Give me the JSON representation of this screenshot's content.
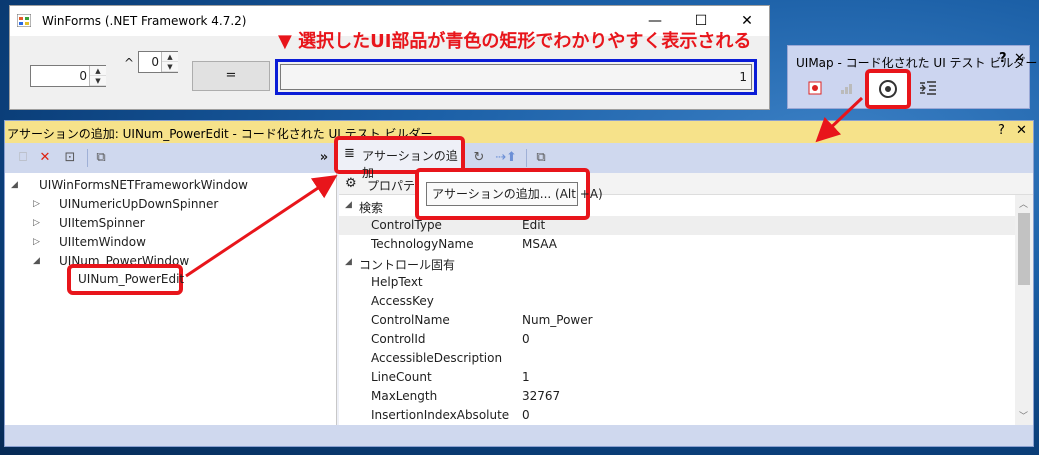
{
  "winforms": {
    "title": "WinForms (.NET Framework 4.7.2)",
    "minimize": "—",
    "maximize": "☐",
    "close": "✕",
    "spinner1_value": "0",
    "caret": "^",
    "spinner2_value": "0",
    "equals_label": "=",
    "result_value": "1"
  },
  "annotation": "▼ 選択したUI部品が青色の矩形でわかりやすく表示される",
  "uimap": {
    "title": "UIMap - コード化された UI テスト ビルダー",
    "help": "?",
    "close": "✕"
  },
  "builder": {
    "title": "アサーションの追加: UINum_PowerEdit - コード化された UI テスト ビルダー",
    "help": "?",
    "close": "✕",
    "toolbar": {
      "chevron": "»",
      "add_assertion": "アサーションの追加"
    },
    "tooltip": "アサーションの追加... (Alt +A)",
    "tree": [
      {
        "label": "UIWinFormsNETFrameworkWindow",
        "expander": "◢"
      },
      {
        "label": "UINumericUpDownSpinner",
        "expander": "▷"
      },
      {
        "label": "UIItemSpinner",
        "expander": "▷"
      },
      {
        "label": "UIItemWindow",
        "expander": "▷"
      },
      {
        "label": "UINum_PowerWindow",
        "expander": "◢"
      }
    ],
    "selected_node": "UINum_PowerEdit",
    "prop_header": "プロパティ",
    "properties": [
      {
        "cat": "検索",
        "expander": "◢"
      },
      {
        "k": "ControlType",
        "v": "Edit"
      },
      {
        "k": "TechnologyName",
        "v": "MSAA"
      },
      {
        "cat": "コントロール固有",
        "expander": "◢"
      },
      {
        "k": "HelpText",
        "v": ""
      },
      {
        "k": "AccessKey",
        "v": ""
      },
      {
        "k": "ControlName",
        "v": "Num_Power"
      },
      {
        "k": "ControlId",
        "v": "0"
      },
      {
        "k": "AccessibleDescription",
        "v": ""
      },
      {
        "k": "LineCount",
        "v": "1"
      },
      {
        "k": "MaxLength",
        "v": "32767"
      },
      {
        "k": "InsertionIndexAbsolute",
        "v": "0"
      }
    ]
  },
  "colors": {
    "highlight_red": "#e8151b",
    "selection_blue": "#0a1cd6",
    "builder_title_bg": "#f6e28a"
  }
}
